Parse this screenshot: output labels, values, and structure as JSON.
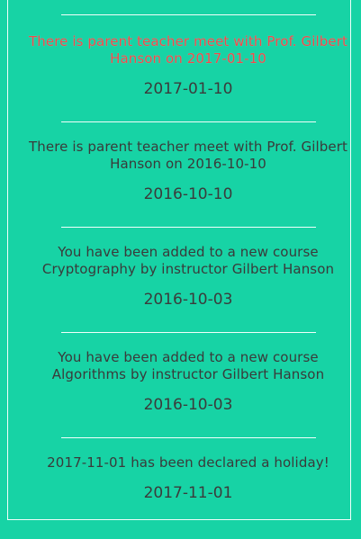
{
  "notifications": [
    {
      "message": "There is parent teacher meet with Prof. Gilbert Hanson on 2017-01-10",
      "date": "2017-01-10",
      "highlighted": true
    },
    {
      "message": "There is parent teacher meet with Prof. Gilbert Hanson on 2016-10-10",
      "date": "2016-10-10",
      "highlighted": false
    },
    {
      "message": "You have been added to a new course Cryptography by instructor Gilbert Hanson",
      "date": "2016-10-03",
      "highlighted": false
    },
    {
      "message": "You have been added to a new course Algorithms by instructor Gilbert Hanson",
      "date": "2016-10-03",
      "highlighted": false
    },
    {
      "message": "2017-11-01 has been declared a holiday!",
      "date": "2017-11-01",
      "highlighted": false
    }
  ],
  "colors": {
    "background": "#17d3a5",
    "text": "#3a3a3a",
    "highlight": "#f04a4a",
    "divider": "#f1fffb"
  }
}
